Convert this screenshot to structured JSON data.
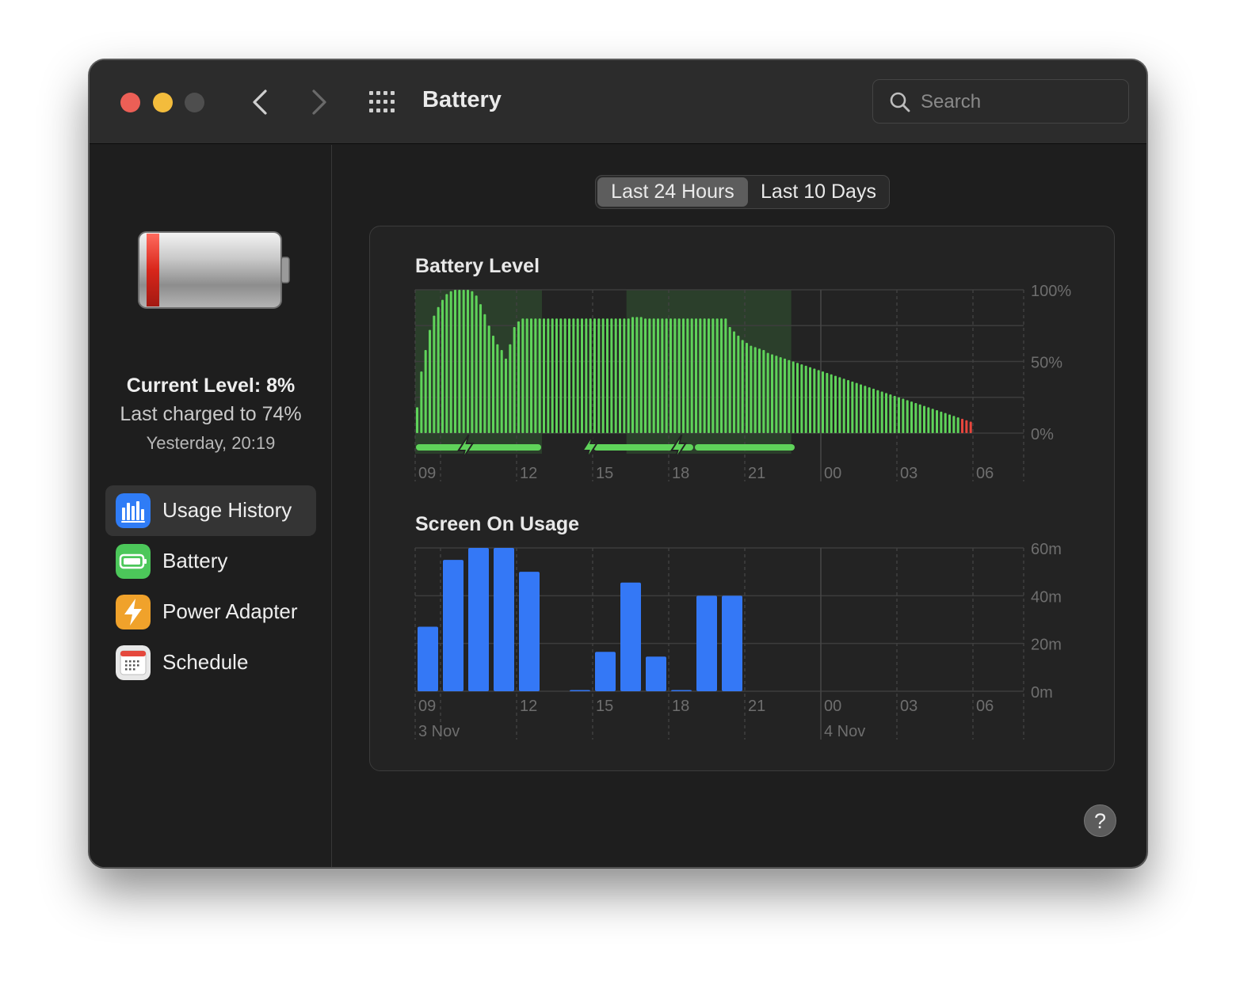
{
  "window": {
    "title": "Battery"
  },
  "search": {
    "placeholder": "Search"
  },
  "status": {
    "current_level": "Current Level: 8%",
    "last_charged": "Last charged to 74%",
    "charged_time": "Yesterday, 20:19"
  },
  "sidebar": {
    "items": [
      {
        "label": "Usage History",
        "icon": "usage-history-icon",
        "color": "#2f7cf6"
      },
      {
        "label": "Battery",
        "icon": "battery-icon",
        "color": "#4cc75a"
      },
      {
        "label": "Power Adapter",
        "icon": "power-adapter-icon",
        "color": "#f0a22b"
      },
      {
        "label": "Schedule",
        "icon": "schedule-icon",
        "color": "#e8e8e8"
      }
    ]
  },
  "segmented": {
    "options": [
      "Last 24 Hours",
      "Last 10 Days"
    ],
    "selected": "Last 24 Hours"
  },
  "help": {
    "label": "?"
  },
  "colors": {
    "battery_green": "#5fd35a",
    "battery_low": "#e8463d",
    "usage_blue": "#3478f6",
    "charging_shade": "#2f4a2f"
  },
  "chart_data": [
    {
      "type": "bar",
      "title": "Battery Level",
      "x_tick_labels": [
        "09",
        "12",
        "15",
        "18",
        "21",
        "00",
        "03",
        "06"
      ],
      "y_tick_labels": [
        "100%",
        "50%",
        "0%"
      ],
      "ylim": [
        0,
        100
      ],
      "grid": true,
      "interval_minutes": 10,
      "start_time": "08:00",
      "values": [
        18,
        43,
        58,
        72,
        82,
        88,
        93,
        97,
        99,
        100,
        100,
        100,
        100,
        99,
        96,
        90,
        83,
        75,
        68,
        62,
        58,
        52,
        62,
        74,
        78,
        80,
        80,
        80,
        80,
        80,
        80,
        80,
        80,
        80,
        80,
        80,
        80,
        80,
        80,
        80,
        80,
        80,
        80,
        80,
        80,
        80,
        80,
        80,
        80,
        80,
        80,
        81,
        81,
        81,
        80,
        80,
        80,
        80,
        80,
        80,
        80,
        80,
        80,
        80,
        80,
        80,
        80,
        80,
        80,
        80,
        80,
        80,
        80,
        80,
        74,
        71,
        68,
        65,
        63,
        61,
        60,
        59,
        58,
        56,
        55,
        54,
        53,
        52,
        51,
        50,
        49,
        48,
        47,
        46,
        45,
        44,
        43,
        42,
        41,
        40,
        39,
        38,
        37,
        36,
        35,
        34,
        33,
        32,
        31,
        30,
        29,
        28,
        27,
        26,
        25,
        24,
        23,
        22,
        21,
        20,
        19,
        18,
        17,
        16,
        15,
        14,
        13,
        12,
        11,
        10,
        9,
        8
      ],
      "low_threshold": 10,
      "charging_periods": [
        {
          "start": "08:00",
          "end": "13:00"
        },
        {
          "start": "16:20",
          "end": "22:50"
        }
      ],
      "legend": "charging bolts shown below chart"
    },
    {
      "type": "bar",
      "title": "Screen On Usage",
      "x_tick_labels": [
        "09",
        "12",
        "15",
        "18",
        "21",
        "00",
        "03",
        "06"
      ],
      "date_labels": [
        "3 Nov",
        "4 Nov"
      ],
      "y_tick_labels": [
        "60m",
        "40m",
        "20m",
        "0m"
      ],
      "ylim": [
        0,
        60
      ],
      "grid": true,
      "interval_minutes": 60,
      "start_time": "08:00",
      "values": [
        27,
        55,
        60,
        60,
        50,
        0,
        0.5,
        16.5,
        45.5,
        14.5,
        0.3,
        40,
        40,
        0,
        0,
        0,
        0,
        0,
        0,
        0,
        0,
        0,
        0,
        0
      ],
      "ylabel": ""
    }
  ]
}
